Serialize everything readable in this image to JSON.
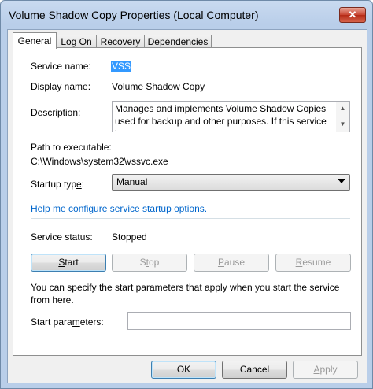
{
  "window": {
    "title": "Volume Shadow Copy Properties (Local Computer)",
    "close_glyph": "✕"
  },
  "tabs": [
    {
      "label": "General"
    },
    {
      "label": "Log On"
    },
    {
      "label": "Recovery"
    },
    {
      "label": "Dependencies"
    }
  ],
  "general": {
    "service_name_label": "Service name:",
    "service_name_value": "VSS",
    "display_name_label": "Display name:",
    "display_name_value": "Volume Shadow Copy",
    "description_label": "Description:",
    "description_value": "Manages and implements Volume Shadow Copies used for backup and other purposes. If this service is",
    "path_label": "Path to executable:",
    "path_value": "C:\\Windows\\system32\\vssvc.exe",
    "startup_type_label_pre": "Startup typ",
    "startup_type_label_key": "e",
    "startup_type_label_post": ":",
    "startup_type_value": "Manual",
    "help_link": "Help me configure service startup options.",
    "status_label": "Service status:",
    "status_value": "Stopped",
    "start_params_note": "You can specify the start parameters that apply when you start the service from here.",
    "start_params_label": "Start para",
    "start_params_label_key": "m",
    "start_params_label_post": "eters:",
    "start_params_value": ""
  },
  "service_buttons": {
    "start": {
      "key": "S",
      "rest": "tart"
    },
    "stop": {
      "pre": "S",
      "key": "t",
      "rest": "op"
    },
    "pause": {
      "key": "P",
      "rest": "ause"
    },
    "resume": {
      "key": "R",
      "rest": "esume"
    }
  },
  "dialog_buttons": {
    "ok": "OK",
    "cancel": "Cancel",
    "apply_key": "A",
    "apply_rest": "pply"
  },
  "colors": {
    "selection": "#3399ff",
    "link": "#0066cc",
    "close": "#c7432f"
  }
}
